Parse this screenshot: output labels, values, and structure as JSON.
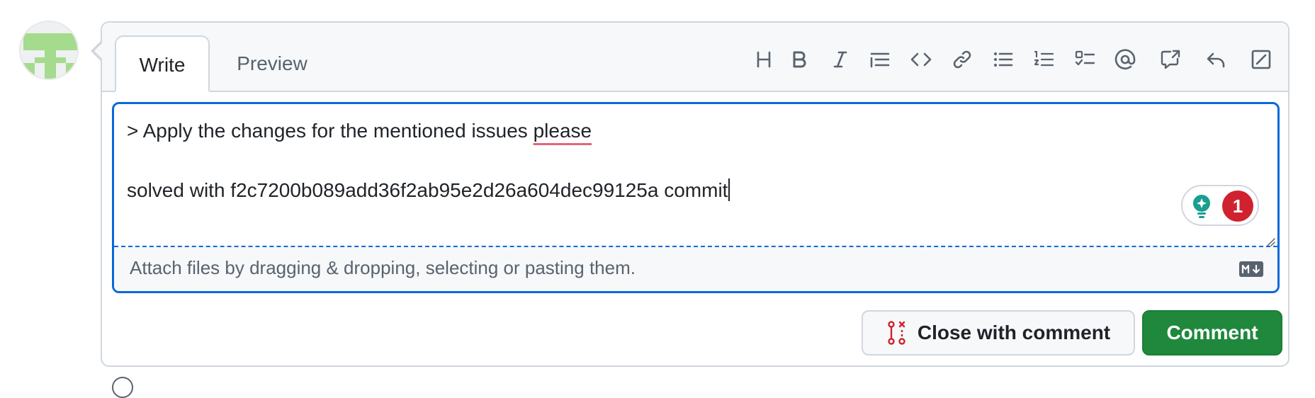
{
  "tabs": {
    "write": "Write",
    "preview": "Preview"
  },
  "toolbar": [
    {
      "name": "heading-icon"
    },
    {
      "name": "bold-icon"
    },
    {
      "name": "italic-icon"
    },
    {
      "name": "quote-icon"
    },
    {
      "name": "code-icon"
    },
    {
      "name": "link-icon"
    },
    {
      "name": "unordered-list-icon"
    },
    {
      "name": "ordered-list-icon"
    },
    {
      "name": "task-list-icon"
    },
    {
      "name": "mention-icon"
    },
    {
      "name": "cross-reference-icon"
    },
    {
      "name": "saved-replies-icon"
    },
    {
      "name": "fullscreen-icon"
    }
  ],
  "editor": {
    "line1_prefix": "> Apply the changes for the mentioned issues ",
    "line1_misspelled": "please",
    "line2": "solved with f2c7200b089add36f2ab95e2d26a604dec99125a commit"
  },
  "assistant": {
    "badge_count": "1",
    "accent": "#1a9e8f",
    "badge_color": "#cf222e"
  },
  "attach": {
    "text": "Attach files by dragging & dropping, selecting or pasting them."
  },
  "buttons": {
    "close_with_comment": "Close with comment",
    "comment": "Comment"
  },
  "colors": {
    "focus_border": "#0969da",
    "comment_button": "#1f883d",
    "close_icon": "#cf222e"
  }
}
